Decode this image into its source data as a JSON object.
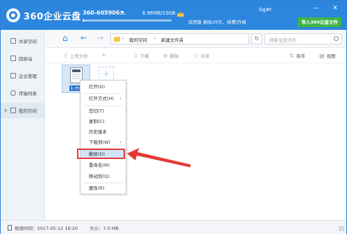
{
  "app": {
    "title": "360企业云盘",
    "account": "360-605906...",
    "usage": "6.96MB/10GB",
    "usage_fraction": 0.0007,
    "trial": "试用版 剩余29天，续费|升级",
    "user": "Gg#r",
    "minimize": "—",
    "close": "✕",
    "import_button": "导入360云盘文件"
  },
  "sidebar": {
    "items": [
      {
        "label": "共享空间",
        "icon": "share-icon"
      },
      {
        "label": "回收站",
        "icon": "recycle-bin-icon"
      },
      {
        "label": "企业管理",
        "icon": "enterprise-icon"
      },
      {
        "label": "传输列表",
        "icon": "transfer-icon"
      },
      {
        "label": "我的空间",
        "icon": "my-space-icon"
      }
    ],
    "active_index": 4
  },
  "nav": {
    "home": "⌂",
    "back": "←",
    "forward": "→",
    "path": [
      "我的空间",
      "新建文件夹"
    ],
    "path_sep": "›",
    "refresh": "↻",
    "search_placeholder": "搜索全部文件"
  },
  "toolbar": {
    "upload": "上传文件",
    "new": "+",
    "download": "下载",
    "delete": "删除",
    "share": "共享",
    "sort": "排序",
    "view": "视图"
  },
  "content": {
    "file_name": "1.m",
    "add_symbol": "+"
  },
  "context_menu": {
    "items": [
      {
        "label": "打开(O)",
        "sub": ""
      },
      {
        "label": "打开方式(H)",
        "sub": "›"
      },
      {
        "label": "剪切(T)",
        "sub": ""
      },
      {
        "label": "复制(C)",
        "sub": ""
      },
      {
        "label": "历史版本",
        "sub": ""
      },
      {
        "label": "下载到(W)",
        "sub": "›"
      },
      {
        "label": "删除(D)",
        "sub": ""
      },
      {
        "label": "重命名(M)",
        "sub": ""
      },
      {
        "label": "移动到(Q)",
        "sub": ""
      },
      {
        "label": "属性(R)",
        "sub": ""
      }
    ],
    "highlighted_index": 6
  },
  "status": {
    "modified": "修改时间：2017-05-12 16:20",
    "size": "大小：7.0 MB"
  },
  "colors": {
    "title_bar": "#2c86dd",
    "import_button": "#3fb449",
    "highlight_box": "#e53935"
  }
}
